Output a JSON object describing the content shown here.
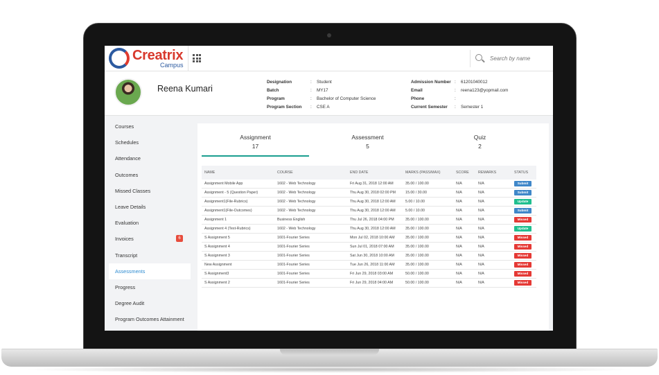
{
  "app": {
    "brand": "Creatrix",
    "brand_sub": "Campus"
  },
  "search": {
    "placeholder": "Search by name"
  },
  "profile": {
    "name": "Reena Kumari",
    "fields_left": [
      {
        "label": "Designation",
        "value": "Student"
      },
      {
        "label": "Batch",
        "value": "MY17"
      },
      {
        "label": "Program",
        "value": "Bachelor of Computer Science"
      },
      {
        "label": "Program Section",
        "value": "CSE A"
      }
    ],
    "fields_right": [
      {
        "label": "Admission Number",
        "value": "61201040012"
      },
      {
        "label": "Email",
        "value": "reena123@yopmail.com"
      },
      {
        "label": "Phone",
        "value": ""
      },
      {
        "label": "Current Semester",
        "value": "Semester 1"
      }
    ]
  },
  "sidebar": {
    "items": [
      {
        "label": "Courses"
      },
      {
        "label": "Schedules"
      },
      {
        "label": "Attendance"
      },
      {
        "label": "Outcomes"
      },
      {
        "label": "Missed Classes"
      },
      {
        "label": "Leave Details"
      },
      {
        "label": "Evaluation"
      },
      {
        "label": "Invoices",
        "badge": "6"
      },
      {
        "label": "Transcript"
      },
      {
        "label": "Assessments",
        "active": true
      },
      {
        "label": "Progress"
      },
      {
        "label": "Degree Audit"
      },
      {
        "label": "Program Outcomes Attainment"
      }
    ]
  },
  "tabs": [
    {
      "label": "Assignment",
      "count": "17",
      "active": true
    },
    {
      "label": "Assessment",
      "count": "5"
    },
    {
      "label": "Quiz",
      "count": "2"
    }
  ],
  "table": {
    "headers": [
      "NAME",
      "COURSE",
      "END DATE",
      "MARKS (PASS/MAX)",
      "SCORE",
      "REMARKS",
      "STATUS"
    ],
    "rows": [
      {
        "name": "Assignment Mobile App",
        "course": "1602 - Web Technology",
        "end_date": "Fri Aug 31, 2018 12:00 AM",
        "late": false,
        "marks": "35.00 / 100.00",
        "score": "N/A",
        "remarks": "N/A",
        "status": "Submit"
      },
      {
        "name": "Assignment - 5 (Question Paper)",
        "course": "1602 - Web Technology",
        "end_date": "Thu Aug 30, 2018 02:00 PM",
        "late": false,
        "marks": "15.00 / 30.00",
        "score": "N/A",
        "remarks": "N/A",
        "status": "Submit"
      },
      {
        "name": "Assignment1(File-Rubrics)",
        "course": "1602 - Web Technology",
        "end_date": "Thu Aug 30, 2018 12:00 AM",
        "late": false,
        "marks": "5.00 / 10.00",
        "score": "N/A",
        "remarks": "N/A",
        "status": "Update"
      },
      {
        "name": "Assignment1(File-Outcomes)",
        "course": "1602 - Web Technology",
        "end_date": "Thu Aug 30, 2018 12:00 AM",
        "late": false,
        "marks": "5.00 / 10.00",
        "score": "N/A",
        "remarks": "N/A",
        "status": "Submit"
      },
      {
        "name": "Assignment 1",
        "course": "Business English",
        "end_date": "Thu Jul 26, 2018 04:00 PM",
        "late": true,
        "marks": "35.00 / 100.00",
        "score": "N/A",
        "remarks": "N/A",
        "status": "Missed"
      },
      {
        "name": "Assignment 4 (Text-Rubrics)",
        "course": "1602 - Web Technology",
        "end_date": "Thu Aug 30, 2018 12:00 AM",
        "late": false,
        "marks": "35.00 / 100.00",
        "score": "N/A",
        "remarks": "N/A",
        "status": "Update"
      },
      {
        "name": "S Assignment 5",
        "course": "1601-Fourier Series",
        "end_date": "Mon Jul 02, 2018 10:00 AM",
        "late": true,
        "marks": "35.00 / 100.00",
        "score": "N/A",
        "remarks": "N/A",
        "status": "Missed"
      },
      {
        "name": "S Assignment 4",
        "course": "1601-Fourier Series",
        "end_date": "Sun Jul 01, 2018 07:00 AM",
        "late": true,
        "marks": "35.00 / 100.00",
        "score": "N/A",
        "remarks": "N/A",
        "status": "Missed"
      },
      {
        "name": "S Assignment 3",
        "course": "1601-Fourier Series",
        "end_date": "Sat Jun 30, 2018 10:00 AM",
        "late": true,
        "marks": "35.00 / 100.00",
        "score": "N/A",
        "remarks": "N/A",
        "status": "Missed"
      },
      {
        "name": "New Assignment",
        "course": "1601-Fourier Series",
        "end_date": "Tue Jun 26, 2018 11:00 AM",
        "late": true,
        "marks": "35.00 / 100.00",
        "score": "N/A",
        "remarks": "N/A",
        "status": "Missed"
      },
      {
        "name": "S Assignment3",
        "course": "1601-Fourier Series",
        "end_date": "Fri Jun 29, 2018 03:00 AM",
        "late": true,
        "marks": "50.00 / 100.00",
        "score": "N/A",
        "remarks": "N/A",
        "status": "Missed"
      },
      {
        "name": "S Assignment 2",
        "course": "1601-Fourier Series",
        "end_date": "Fri Jun 29, 2018 04:00 AM",
        "late": true,
        "marks": "50.00 / 100.00",
        "score": "N/A",
        "remarks": "N/A",
        "status": "Missed"
      }
    ]
  }
}
